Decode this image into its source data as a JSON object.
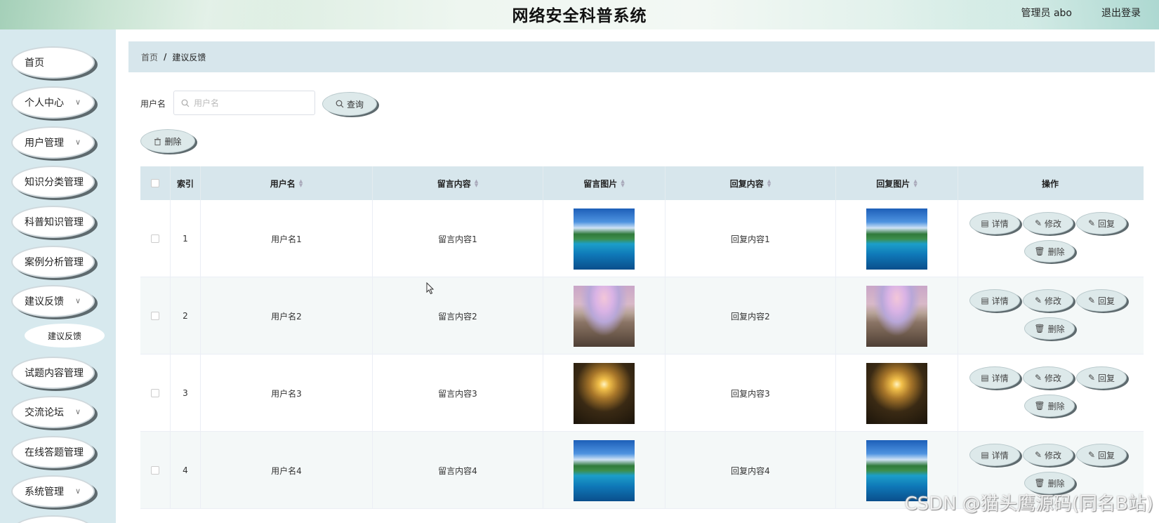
{
  "header": {
    "title": "网络安全科普系统",
    "user_info": "管理员 abo",
    "logout_label": "退出登录"
  },
  "sidebar": {
    "items": [
      {
        "label": "首页",
        "has_children": false
      },
      {
        "label": "个人中心",
        "has_children": true
      },
      {
        "label": "用户管理",
        "has_children": true
      },
      {
        "label": "知识分类管理",
        "has_children": true
      },
      {
        "label": "科普知识管理",
        "has_children": true
      },
      {
        "label": "案例分析管理",
        "has_children": true
      },
      {
        "label": "建议反馈",
        "has_children": true
      },
      {
        "label": "试题内容管理",
        "has_children": true
      },
      {
        "label": "交流论坛",
        "has_children": true
      },
      {
        "label": "在线答题管理",
        "has_children": true
      },
      {
        "label": "系统管理",
        "has_children": true
      }
    ],
    "active_sub": "建议反馈"
  },
  "breadcrumb": {
    "home": "首页",
    "separator": "/",
    "current": "建议反馈"
  },
  "search": {
    "label": "用户名",
    "placeholder": "用户名",
    "value": "",
    "button_label": "查询"
  },
  "toolbar": {
    "delete_label": "删除"
  },
  "table": {
    "columns": [
      "索引",
      "用户名",
      "留言内容",
      "留言图片",
      "回复内容",
      "回复图片",
      "操作"
    ],
    "rows": [
      {
        "index": "1",
        "username": "用户名1",
        "message": "留言内容1",
        "message_image": "island-lagoon-photo",
        "reply": "回复内容1",
        "reply_image": "island-lagoon-photo"
      },
      {
        "index": "2",
        "username": "用户名2",
        "message": "留言内容2",
        "message_image": "rainbow-path-photo",
        "reply": "回复内容2",
        "reply_image": "rainbow-path-photo"
      },
      {
        "index": "3",
        "username": "用户名3",
        "message": "留言内容3",
        "message_image": "sunset-beach-photo",
        "reply": "回复内容3",
        "reply_image": "sunset-beach-photo"
      },
      {
        "index": "4",
        "username": "用户名4",
        "message": "留言内容4",
        "message_image": "island-lagoon-photo",
        "reply": "回复内容4",
        "reply_image": "island-lagoon-photo"
      }
    ],
    "row_actions": {
      "detail": "详情",
      "edit": "修改",
      "reply": "回复",
      "delete": "删除"
    }
  },
  "watermark": "CSDN @猫头鹰源码(同名B站)",
  "colors": {
    "sidebar_bg": "#d7e9ee",
    "header_row_bg": "#d7e6ec",
    "pill_bg": "#dde9ea",
    "pill_shadow": "#5e6a6e"
  }
}
